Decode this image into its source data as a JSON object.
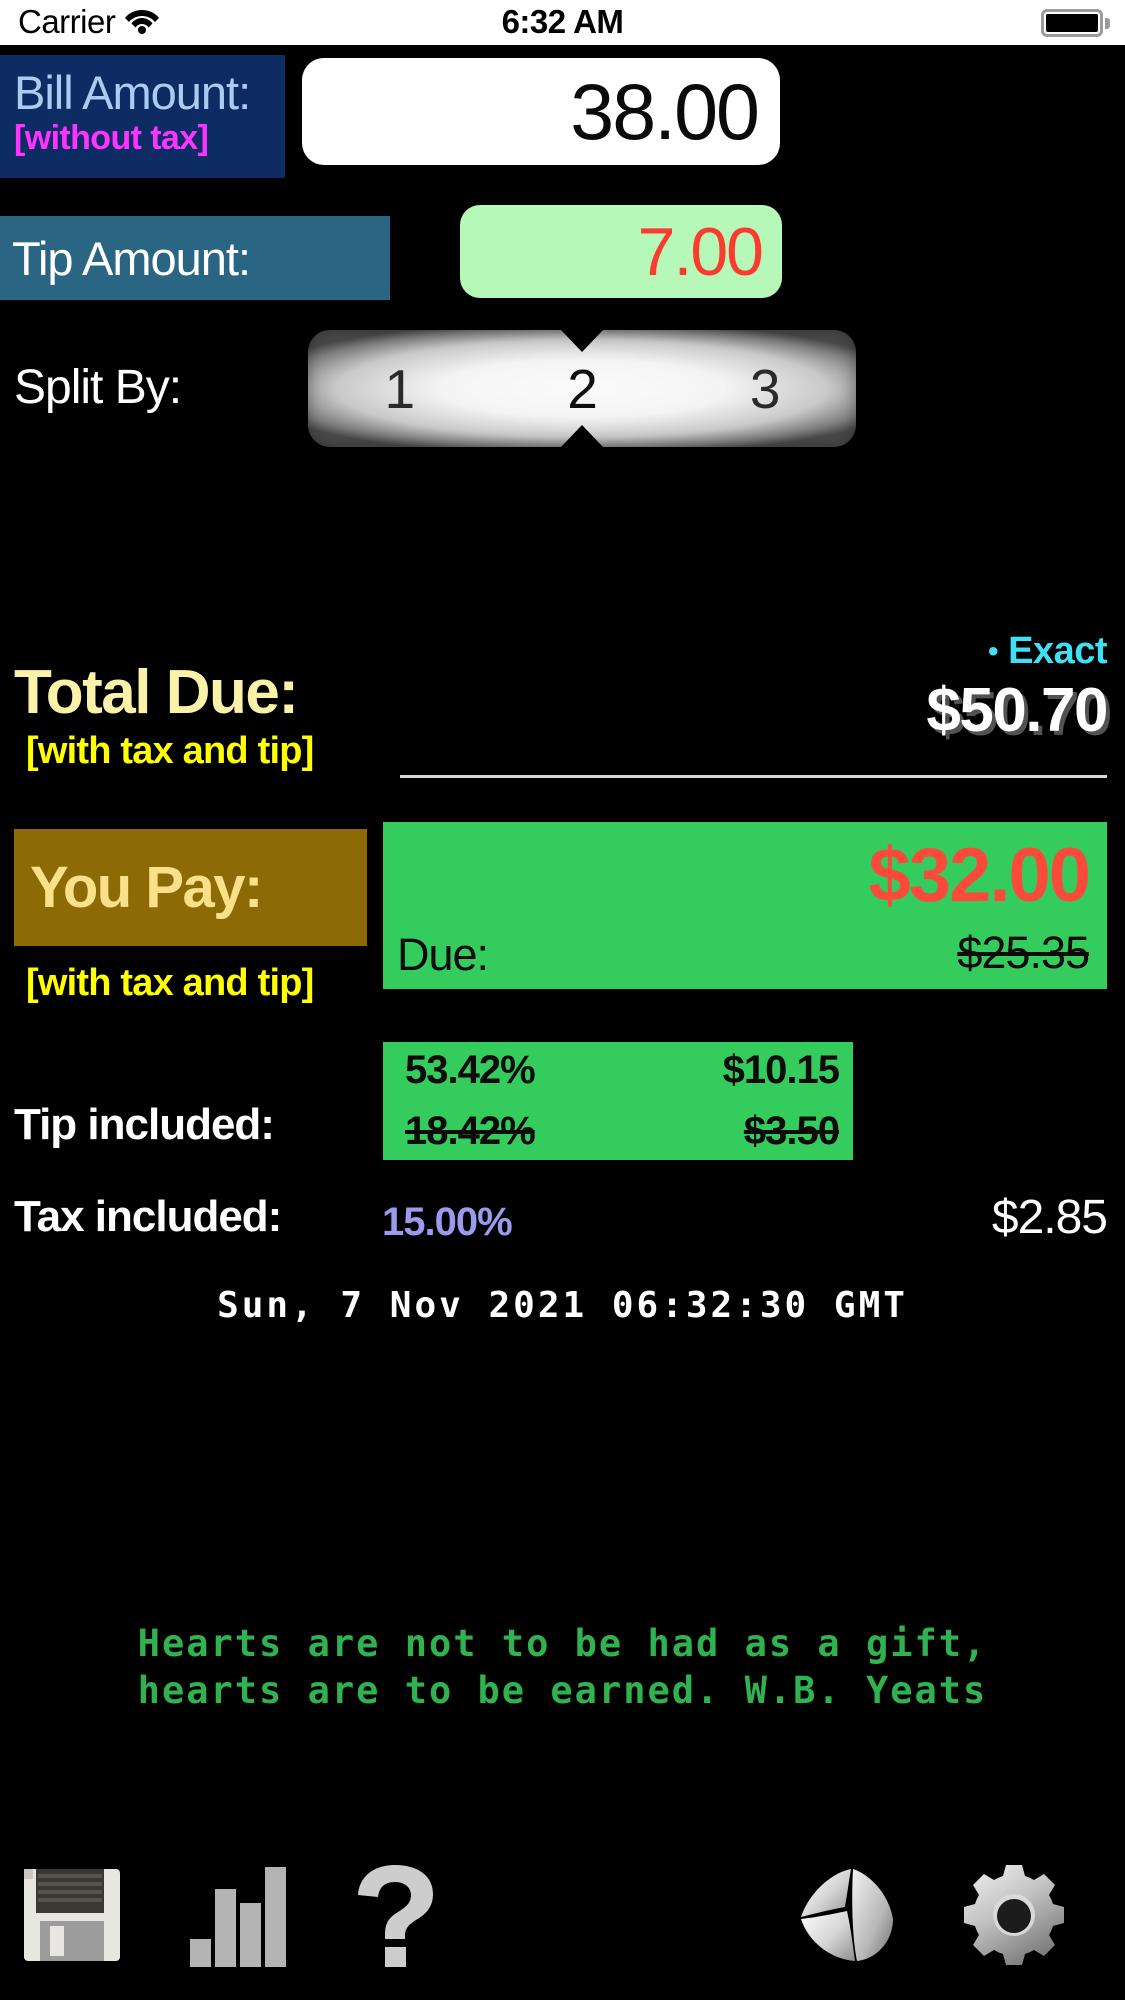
{
  "statusbar": {
    "carrier": "Carrier",
    "time": "6:32 AM",
    "wifi_icon": "wifi-icon",
    "battery_icon": "battery-icon"
  },
  "bill": {
    "label": "Bill Amount:",
    "sublabel": "[without tax]",
    "value": "38.00"
  },
  "tip": {
    "label": "Tip Amount:",
    "value": "7.00"
  },
  "split": {
    "label": "Split By:",
    "options": [
      "1",
      "2",
      "3"
    ],
    "selected": "2"
  },
  "exact": {
    "bullet": "•",
    "label": "Exact"
  },
  "total_due": {
    "label": "Total Due:",
    "sublabel": "[with tax and tip]",
    "value": "$50.70"
  },
  "you_pay": {
    "label": "You Pay:",
    "sublabel": "[with tax and tip]",
    "value": "$32.00",
    "due_label": "Due:",
    "due_value": "$25.35"
  },
  "tip_included": {
    "label": "Tip included:",
    "percent_new": "53.42%",
    "amount_new": "$10.15",
    "percent_old": "18.42%",
    "amount_old": "$3.50"
  },
  "tax_included": {
    "label": "Tax included:",
    "percent": "15.00%",
    "amount": "$2.85"
  },
  "datetime": "Sun, 7 Nov 2021 06:32:30 GMT",
  "quote": {
    "line1": "Hearts are not to be had as a gift,",
    "line2": "hearts are to be earned. W.B. Yeats"
  },
  "toolbar": {
    "items": [
      {
        "name": "save-icon",
        "label": "Save"
      },
      {
        "name": "bar-chart-icon",
        "label": "Statistics"
      },
      {
        "name": "question-mark-icon",
        "label": "Help"
      },
      {
        "name": "fortune-cookie-icon",
        "label": "Fortune"
      },
      {
        "name": "gear-icon",
        "label": "Settings"
      }
    ]
  },
  "colors": {
    "background": "#000000",
    "bill_label_bg": "#0d2c63",
    "bill_label_fg": "#a8cdf2",
    "bill_sub_fg": "#ff33ff",
    "tip_label_bg": "#2b6584",
    "tip_field_bg": "#b6f8b8",
    "tip_field_fg": "#fb3b2e",
    "exact_fg": "#3fe0f5",
    "total_due_fg": "#faf2a8",
    "sub_yellow": "#ffff00",
    "you_pay_bg": "#8c6a06",
    "you_pay_fg": "#fbe08a",
    "green_panel": "#35cc5e",
    "red_value": "#fb4a3c",
    "tax_percent": "#9a9aee",
    "quote_fg": "#2fb24f"
  }
}
